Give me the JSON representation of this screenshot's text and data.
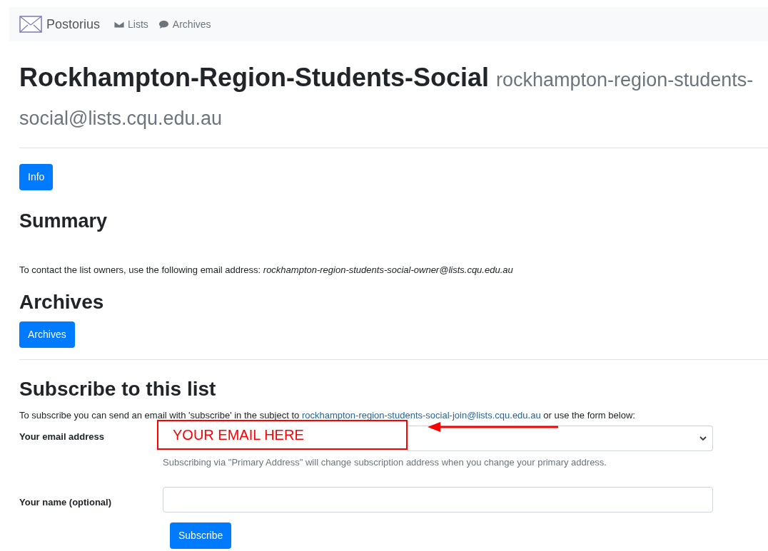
{
  "navbar": {
    "brand": "Postorius",
    "links": [
      {
        "label": "Lists"
      },
      {
        "label": "Archives"
      }
    ]
  },
  "header": {
    "title": "Rockhampton-Region-Students-Social",
    "address_lines": [
      "rockhampton-region-students-",
      "social@lists.cqu.edu.au"
    ]
  },
  "info_button": "Info",
  "summary": {
    "heading": "Summary",
    "contact_text": "To contact the list owners, use the following email address: ",
    "owner_address": "rockhampton-region-students-social-owner@lists.cqu.edu.au"
  },
  "archives": {
    "heading": "Archives",
    "button": "Archives"
  },
  "subscribe": {
    "heading": "Subscribe to this list",
    "intro_before": "To subscribe you can send an email with 'subscribe' in the subject to ",
    "join_link": "rockhampton-region-students-social-join@lists.cqu.edu.au",
    "intro_after": " or use the form below:",
    "email_label": "Your email address",
    "email_help": "Subscribing via \"Primary Address\" will change subscription address when you change your primary address.",
    "name_label": "Your name (optional)",
    "button": "Subscribe"
  },
  "annotation": {
    "text": "YOUR EMAIL HERE"
  }
}
